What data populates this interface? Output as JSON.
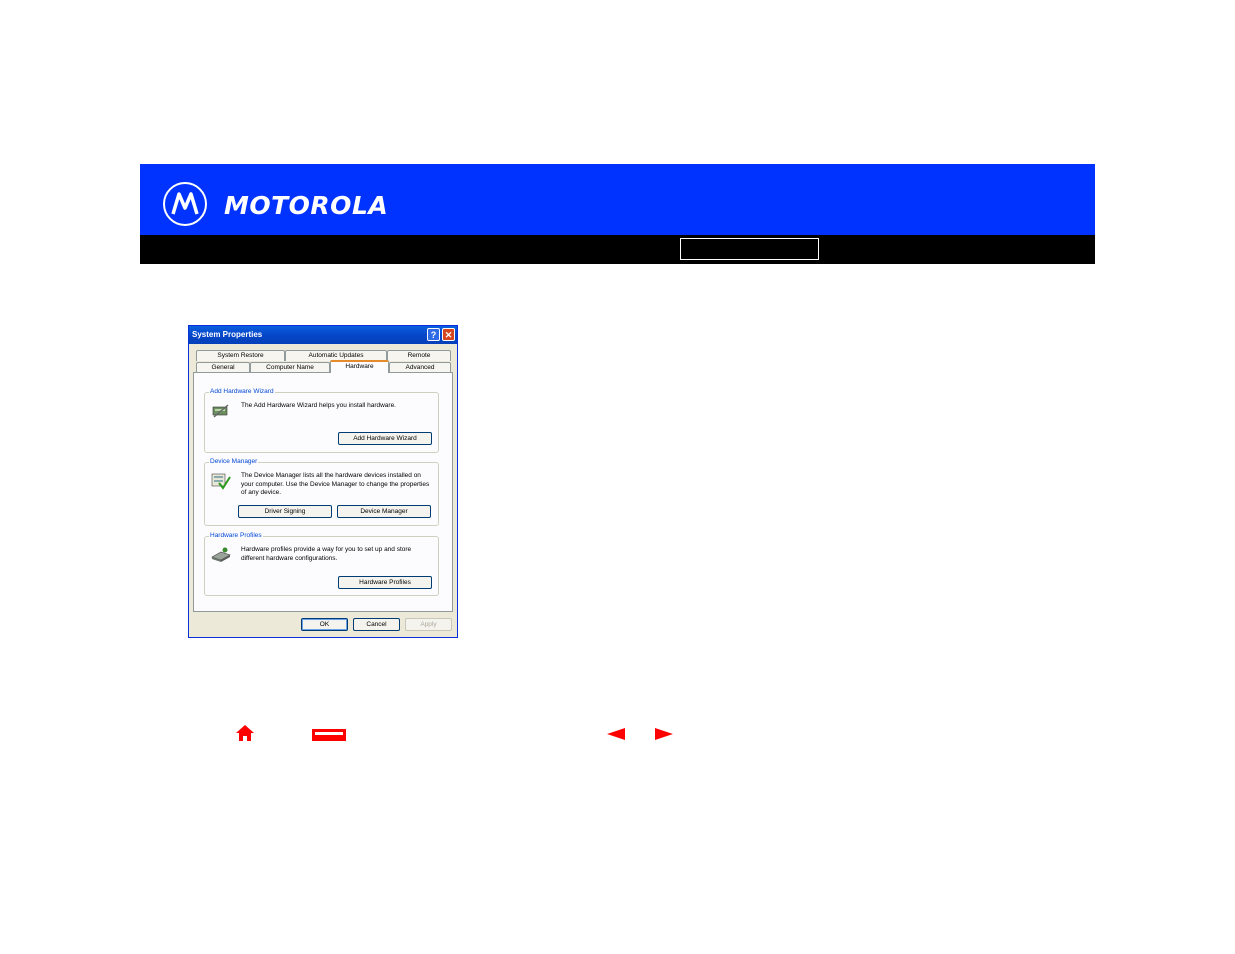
{
  "header": {
    "logo_text": "MOTOROLA",
    "banner_color": "#0033ff"
  },
  "dialog": {
    "title": "System Properties",
    "tabs_top": [
      "System Restore",
      "Automatic Updates",
      "Remote"
    ],
    "tabs_bottom": [
      "General",
      "Computer Name",
      "Hardware",
      "Advanced"
    ],
    "active_tab": "Hardware",
    "add_hardware": {
      "label": "Add Hardware Wizard",
      "text": "The Add Hardware Wizard helps you install hardware.",
      "button": "Add Hardware Wizard"
    },
    "device_manager": {
      "label": "Device Manager",
      "text": "The Device Manager lists all the hardware devices installed on your computer. Use the Device Manager to change the properties of any device.",
      "driver_signing_button": "Driver Signing",
      "device_manager_button": "Device Manager"
    },
    "hardware_profiles": {
      "label": "Hardware Profiles",
      "text": "Hardware profiles provide a way for you to set up and store different hardware configurations.",
      "button": "Hardware Profiles"
    },
    "ok_button": "OK",
    "cancel_button": "Cancel",
    "apply_button": "Apply"
  },
  "footer_nav": {
    "icons": [
      "home-icon",
      "print-icon",
      "previous-arrow-icon",
      "next-arrow-icon"
    ],
    "icon_color": "#ff0000"
  }
}
